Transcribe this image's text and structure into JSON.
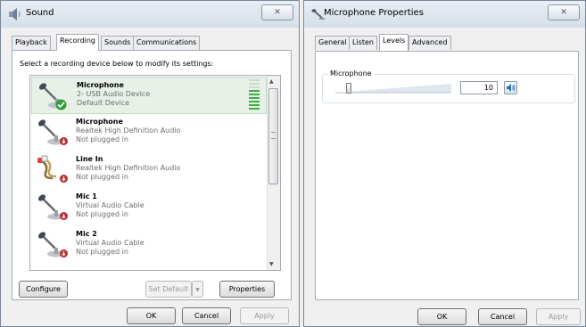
{
  "sound_window": {
    "title": "Sound",
    "close_glyph": "✕",
    "tabs": [
      "Playback",
      "Recording",
      "Sounds",
      "Communications"
    ],
    "active_tab": "Recording",
    "instruction": "Select a recording device below to modify its settings:",
    "devices": [
      {
        "name": "Microphone",
        "description": "2- USB Audio Device",
        "status": "Default Device",
        "icon": "microphone-icon",
        "badge": "default-check-icon",
        "selected": true,
        "level_bars": 9,
        "level_filled": 6
      },
      {
        "name": "Microphone",
        "description": "Realtek High Definition Audio",
        "status": "Not plugged in",
        "icon": "microphone-icon",
        "badge": "unplugged-icon",
        "selected": false
      },
      {
        "name": "Line In",
        "description": "Realtek High Definition Audio",
        "status": "Not plugged in",
        "icon": "line-in-cable-icon",
        "badge": "unplugged-icon",
        "selected": false
      },
      {
        "name": "Mic 1",
        "description": "Virtual Audio Cable",
        "status": "Not plugged in",
        "icon": "microphone-icon",
        "badge": "unplugged-icon",
        "selected": false
      },
      {
        "name": "Mic 2",
        "description": "Virtual Audio Cable",
        "status": "Not plugged in",
        "icon": "microphone-icon",
        "badge": "unplugged-icon",
        "selected": false
      }
    ],
    "buttons": {
      "configure": "Configure",
      "set_default": "Set Default",
      "properties": "Properties",
      "ok": "OK",
      "cancel": "Cancel",
      "apply": "Apply"
    },
    "colors": {
      "level_on": "#3cb043",
      "level_off": "#cfd9cf",
      "check_badge": "#2e9e36",
      "unplugged_badge": "#c0282d"
    }
  },
  "properties_window": {
    "title": "Microphone Properties",
    "close_glyph": "✕",
    "tabs": [
      "General",
      "Listen",
      "Levels",
      "Advanced"
    ],
    "active_tab": "Levels",
    "level_group_label": "Microphone",
    "level_value": "10",
    "level_fraction": 0.1,
    "speaker_icon": "speaker-icon",
    "buttons": {
      "ok": "OK",
      "cancel": "Cancel",
      "apply": "Apply"
    }
  }
}
